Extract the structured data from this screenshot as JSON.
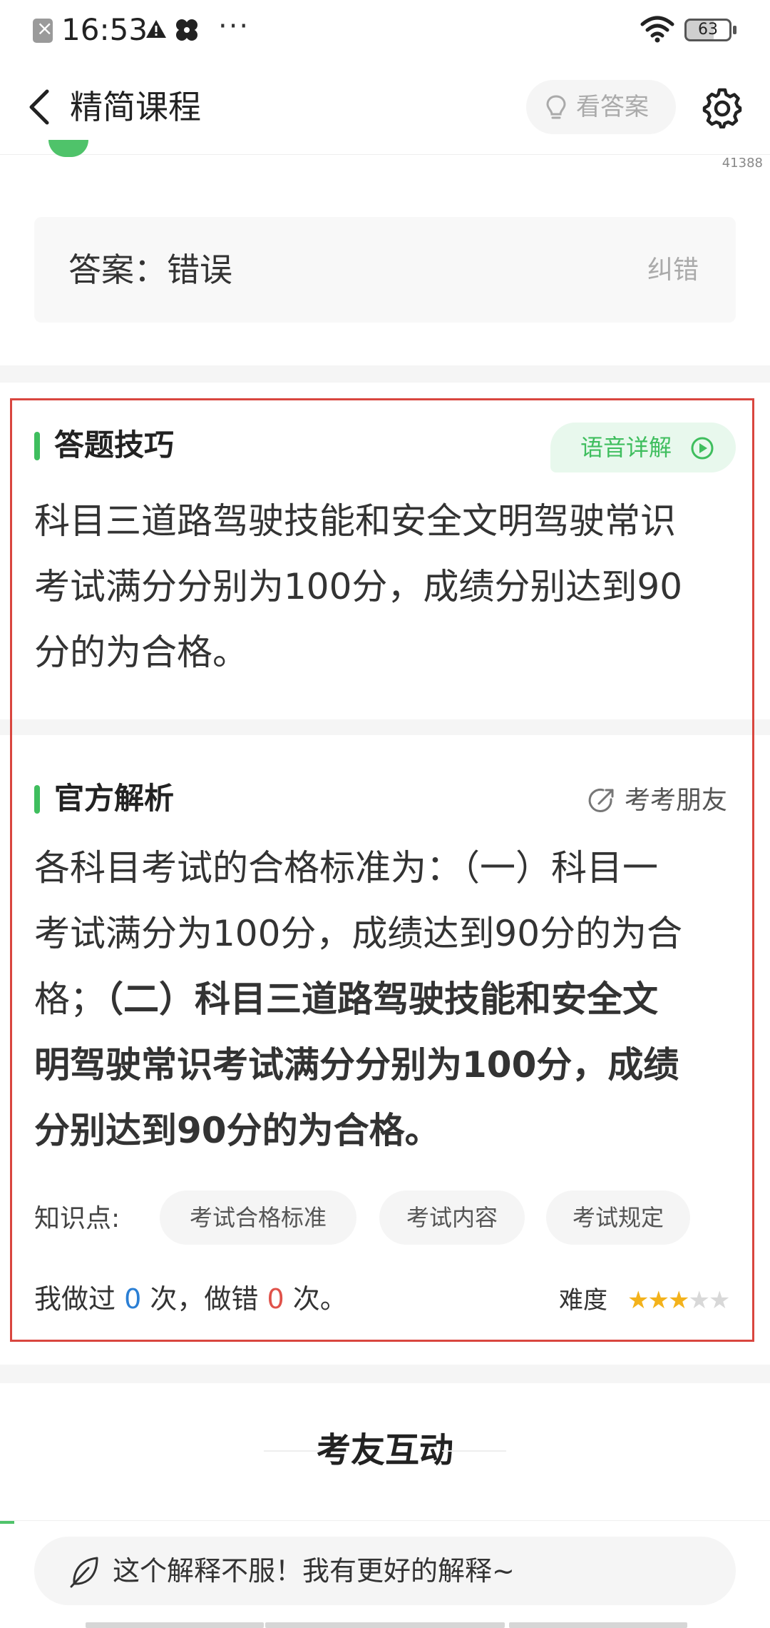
{
  "status_bar": {
    "time": "16:53",
    "battery": "63",
    "more": "···",
    "icons": [
      "app-notification-icon",
      "warning-icon",
      "pinwheel-icon",
      "more-icon",
      "wifi-icon",
      "battery-icon"
    ]
  },
  "nav": {
    "title": "精简课程",
    "view_answer": "看答案",
    "icons": [
      "back-arrow-icon",
      "bulb-icon",
      "gear-icon"
    ]
  },
  "question": {
    "id": "41388",
    "answer_label": "答案：错误",
    "correct_error": "纠错"
  },
  "tips": {
    "title": "答题技巧",
    "voice_button": "语音详解",
    "lines": [
      "科目三道路驾驶技能和安全文明驾驶常识",
      "考试满分分别为100分，成绩分别达到90",
      "分的为合格。"
    ]
  },
  "official": {
    "title": "官方解析",
    "share": "考考朋友",
    "lines_normal": [
      "各科目考试的合格标准为：（一）科目一",
      "考试满分为100分，成绩达到90分的为合",
      "格；"
    ],
    "line3_bold": "（二）科目三道路驾驶技能和安全文",
    "lines_bold": [
      "明驾驶常识考试满分分别为100分，成绩",
      "分别达到90分的为合格。"
    ]
  },
  "knowledge": {
    "label": "知识点:",
    "tags": [
      "考试合格标准",
      "考试内容",
      "考试规定"
    ]
  },
  "stats": {
    "prefix": "我做过 ",
    "done_count": "0",
    "middle": " 次，做错 ",
    "wrong_count": "0",
    "suffix": " 次。",
    "difficulty_label": "难度",
    "difficulty_stars": 3,
    "difficulty_max": 5
  },
  "interaction": {
    "title": "考友互动"
  },
  "bottom": {
    "comment_prompt": "这个解释不服！我有更好的解释~"
  },
  "colors": {
    "accent_green": "#3fbe5e",
    "highlight_red": "#d9463f",
    "star_gold": "#f3b21b",
    "count_blue": "#2b7fd4",
    "count_red": "#e0524a"
  }
}
